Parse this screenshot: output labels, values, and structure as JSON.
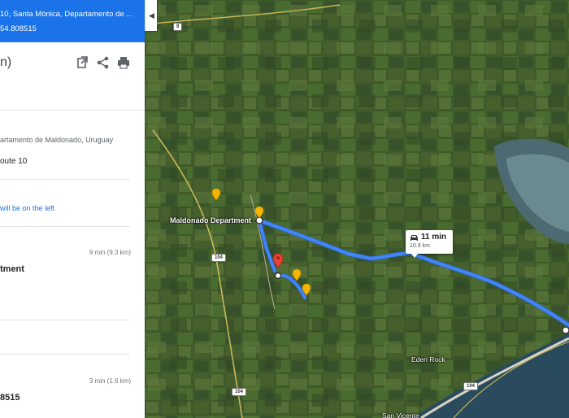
{
  "header": {
    "address_line": "10, Santa Mónica, Departamento de ...",
    "coords_line": "54.808515"
  },
  "summary": {
    "text": "n)",
    "icons": [
      "open-in-new-icon",
      "share-icon",
      "print-icon"
    ]
  },
  "steps": {
    "origin": "artamento de Maldonado, Uruguay",
    "route": "oute 10",
    "left_note": "will be on the left",
    "time_1": "9 min (9.3 km)",
    "bold_1": "tment",
    "time_2": "3 min (1.6 km)",
    "bold_2": "8515"
  },
  "map": {
    "labels": {
      "department": "Maldonado Department",
      "eden_rock": "Eden Rock",
      "san_vicente": "San Vicente"
    },
    "road_shields": {
      "top": "9",
      "r104a": "104",
      "r104b": "104",
      "r104c": "104"
    },
    "route_card": {
      "time": "11 min",
      "distance": "10.9 km"
    },
    "colors": {
      "route": "#4285f4",
      "header": "#1a73e8",
      "pin": "#ea4335",
      "poi": "#f4b400",
      "water": "#2a4a5e",
      "fields": "#3f5a2a"
    }
  }
}
